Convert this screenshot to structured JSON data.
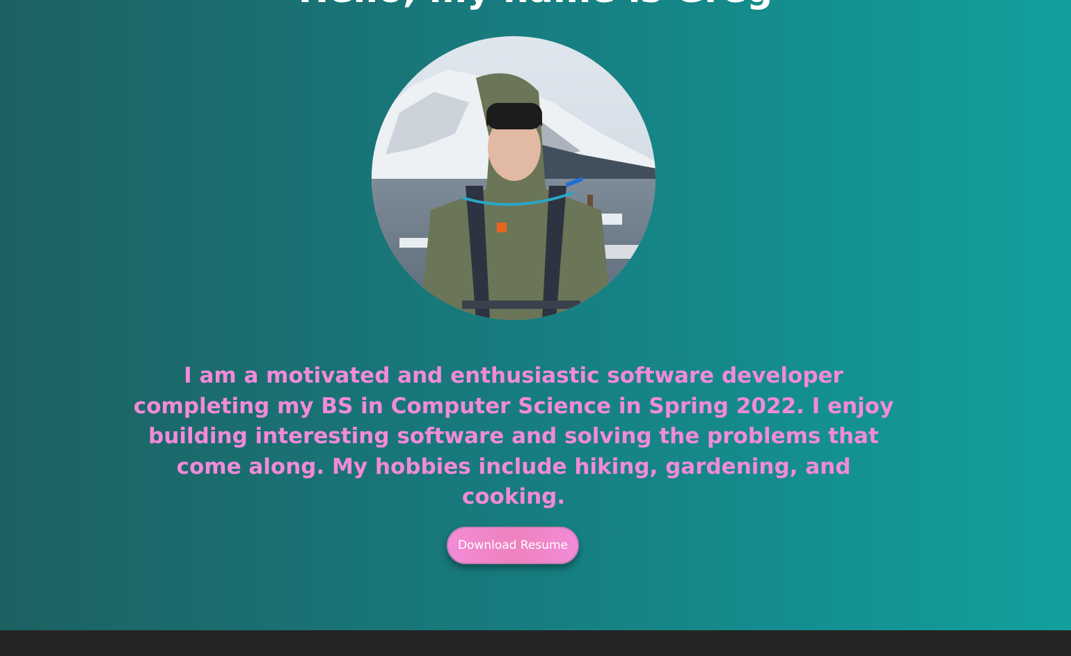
{
  "hero": {
    "heading": "Hello, my name is Greg",
    "bio": "I am a motivated and enthusiastic software developer completing my BS in Computer Science in Spring 2022. I enjoy building interesting software and solving the problems that come along. My hobbies include hiking, gardening, and cooking.",
    "resume_button_label": "Download Resume"
  },
  "colors": {
    "gradient_start": "#1d6162",
    "gradient_end": "#12a09e",
    "bio_text": "#f28ad8",
    "button_pink": "#f38bd8",
    "footer": "#242424"
  }
}
